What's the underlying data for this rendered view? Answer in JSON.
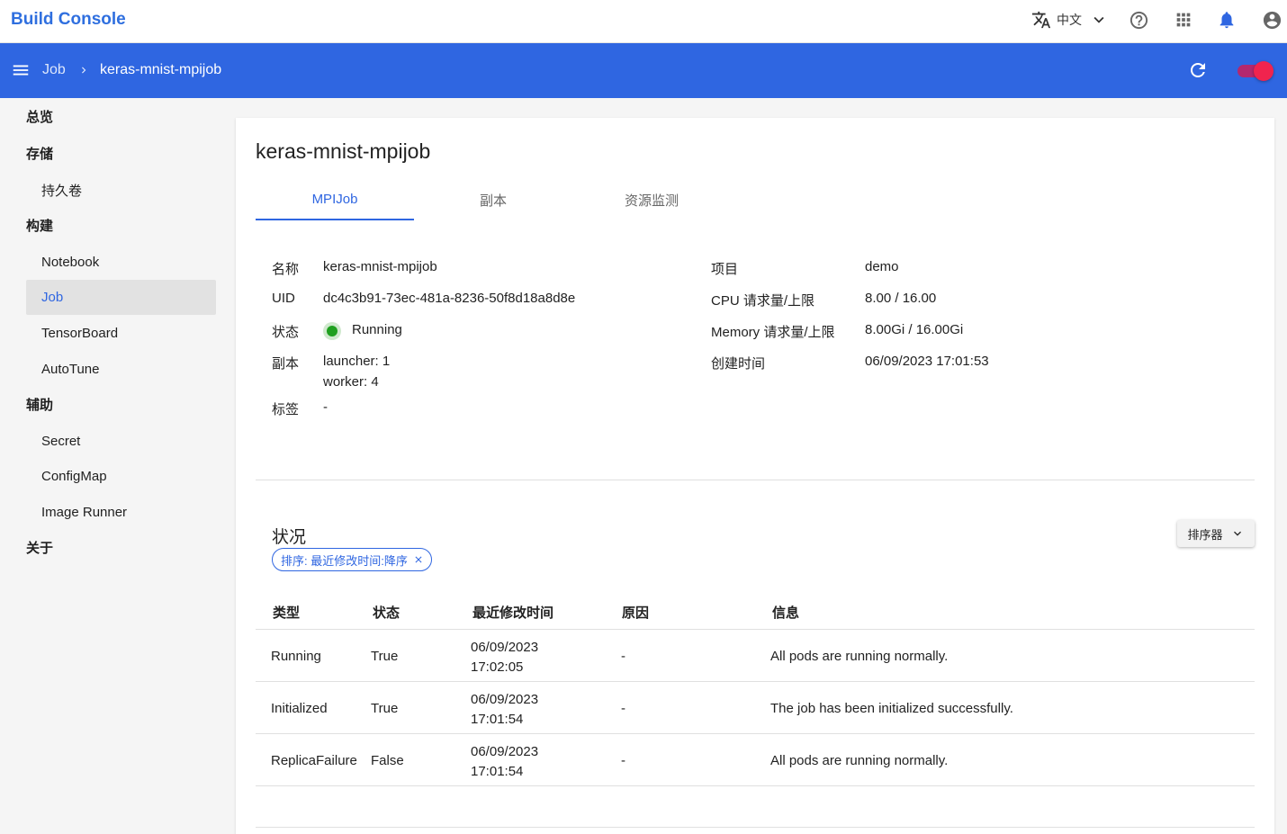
{
  "app": {
    "title": "Build Console"
  },
  "topbar": {
    "language": "中文"
  },
  "breadcrumb": {
    "parent": "Job",
    "current": "keras-mnist-mpijob"
  },
  "sidebar": {
    "overview": "总览",
    "storage": "存储",
    "persistent_volume": "持久卷",
    "build": "构建",
    "notebook": "Notebook",
    "job": "Job",
    "tensorboard": "TensorBoard",
    "autotune": "AutoTune",
    "auxiliary": "辅助",
    "secret": "Secret",
    "configmap": "ConfigMap",
    "image_runner": "Image Runner",
    "about": "关于"
  },
  "main": {
    "title": "keras-mnist-mpijob",
    "tabs": [
      "MPIJob",
      "副本",
      "资源监测"
    ],
    "info": {
      "name_label": "名称",
      "name": "keras-mnist-mpijob",
      "uid_label": "UID",
      "uid": "dc4c3b91-73ec-481a-8236-50f8d18a8d8e",
      "status_label": "状态",
      "status": "Running",
      "replicas_label": "副本",
      "replica_launcher": "launcher: 1",
      "replica_worker": "worker: 4",
      "labels_label": "标签",
      "labels": "-",
      "project_label": "项目",
      "project": "demo",
      "cpu_label": "CPU 请求量/上限",
      "cpu": "8.00 / 16.00",
      "memory_label": "Memory 请求量/上限",
      "memory": "8.00Gi / 16.00Gi",
      "created_label": "创建时间",
      "created": "06/09/2023 17:01:53"
    },
    "conditions": {
      "title": "状况",
      "sort_chip": "排序: 最近修改时间:降序",
      "sorter_label": "排序器",
      "headers": [
        "类型",
        "状态",
        "最近修改时间",
        "原因",
        "信息"
      ],
      "rows": [
        {
          "type": "Running",
          "status": "True",
          "date": "06/09/2023",
          "time": "17:02:05",
          "reason": "-",
          "message": "All pods are running normally."
        },
        {
          "type": "Initialized",
          "status": "True",
          "date": "06/09/2023",
          "time": "17:01:54",
          "reason": "-",
          "message": "The job has been initialized successfully."
        },
        {
          "type": "ReplicaFailure",
          "status": "False",
          "date": "06/09/2023",
          "time": "17:01:54",
          "reason": "-",
          "message": "All pods are running normally."
        }
      ]
    }
  },
  "colors": {
    "primary": "#2f66e1",
    "brand": "#2f6fdf",
    "status_running": "#1fa01f",
    "toggle": "#f0244e"
  },
  "icons": [
    "translate-icon",
    "chevron-down-icon",
    "help-icon",
    "apps-grid-icon",
    "bell-icon",
    "account-icon",
    "menu-icon",
    "chevron-right-icon",
    "refresh-icon",
    "close-icon"
  ]
}
